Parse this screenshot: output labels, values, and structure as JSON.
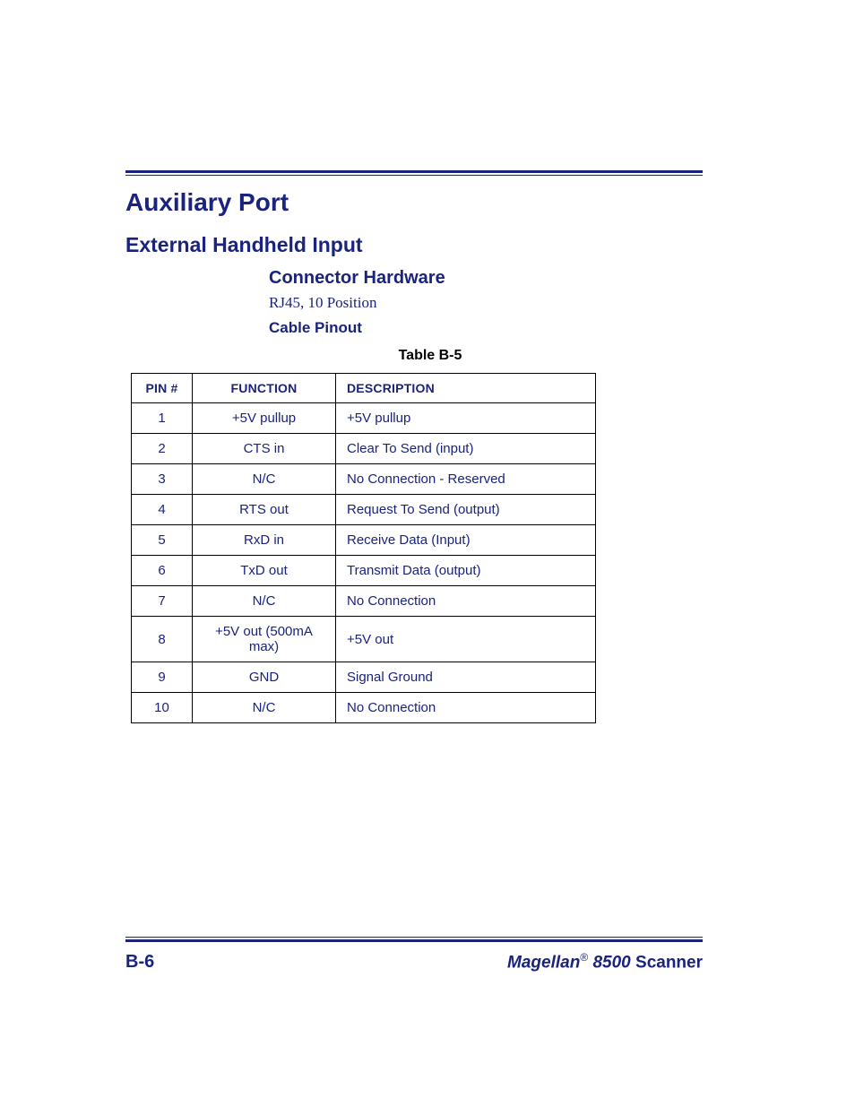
{
  "headings": {
    "h1": "Auxiliary Port",
    "h2": "External Handheld Input",
    "h3": "Connector Hardware",
    "body": "RJ45, 10 Position",
    "h4": "Cable Pinout",
    "tableCaption": "Table B-5"
  },
  "table": {
    "headers": {
      "pin": "PIN #",
      "func": "FUNCTION",
      "desc": "DESCRIPTION"
    },
    "rows": [
      {
        "pin": "1",
        "func": "+5V pullup",
        "desc": "+5V pullup"
      },
      {
        "pin": "2",
        "func": "CTS in",
        "desc": "Clear To Send (input)"
      },
      {
        "pin": "3",
        "func": "N/C",
        "desc": "No Connection - Reserved"
      },
      {
        "pin": "4",
        "func": "RTS out",
        "desc": "Request To Send (output)"
      },
      {
        "pin": "5",
        "func": "RxD in",
        "desc": "Receive Data (Input)"
      },
      {
        "pin": "6",
        "func": "TxD out",
        "desc": "Transmit Data (output)"
      },
      {
        "pin": "7",
        "func": "N/C",
        "desc": "No Connection"
      },
      {
        "pin": "8",
        "func": "+5V out (500mA max)",
        "desc": "+5V out"
      },
      {
        "pin": "9",
        "func": "GND",
        "desc": "Signal Ground"
      },
      {
        "pin": "10",
        "func": "N/C",
        "desc": "No Connection"
      }
    ]
  },
  "footer": {
    "pageNum": "B-6",
    "brand": "Magellan",
    "reg": "®",
    "model": " 8500 ",
    "scan": "Scanner"
  }
}
